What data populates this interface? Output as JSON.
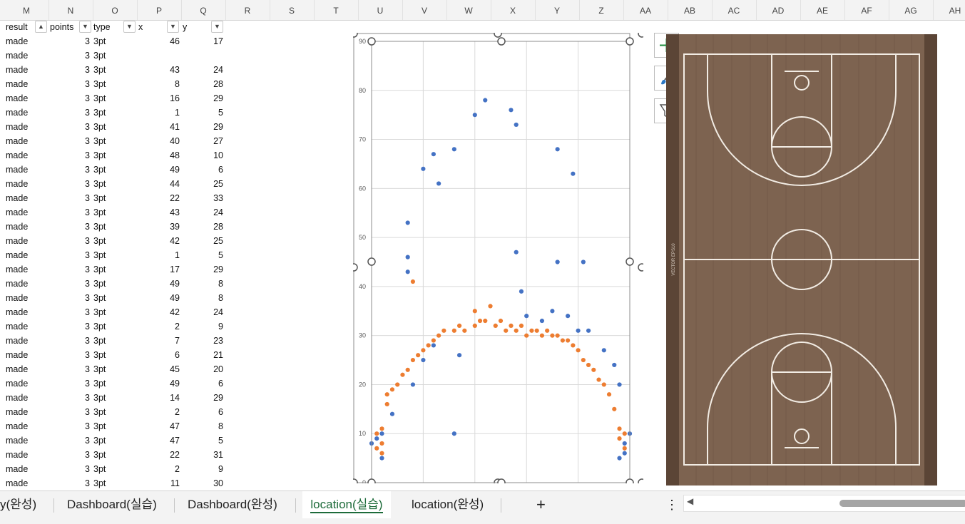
{
  "columns": [
    "M",
    "N",
    "O",
    "P",
    "Q",
    "R",
    "S",
    "T",
    "U",
    "V",
    "W",
    "X",
    "Y",
    "Z",
    "AA",
    "AB",
    "AC",
    "AD",
    "AE",
    "AF",
    "AG",
    "AH"
  ],
  "table": {
    "headers": [
      "result",
      "points",
      "type",
      "x",
      "y"
    ],
    "rows": [
      [
        "made",
        "3",
        "3pt",
        "46",
        "17"
      ],
      [
        "made",
        "3",
        "3pt",
        "",
        ""
      ],
      [
        "made",
        "3",
        "3pt",
        "43",
        "24"
      ],
      [
        "made",
        "3",
        "3pt",
        "8",
        "28"
      ],
      [
        "made",
        "3",
        "3pt",
        "16",
        "29"
      ],
      [
        "made",
        "3",
        "3pt",
        "1",
        "5"
      ],
      [
        "made",
        "3",
        "3pt",
        "41",
        "29"
      ],
      [
        "made",
        "3",
        "3pt",
        "40",
        "27"
      ],
      [
        "made",
        "3",
        "3pt",
        "48",
        "10"
      ],
      [
        "made",
        "3",
        "3pt",
        "49",
        "6"
      ],
      [
        "made",
        "3",
        "3pt",
        "44",
        "25"
      ],
      [
        "made",
        "3",
        "3pt",
        "22",
        "33"
      ],
      [
        "made",
        "3",
        "3pt",
        "43",
        "24"
      ],
      [
        "made",
        "3",
        "3pt",
        "39",
        "28"
      ],
      [
        "made",
        "3",
        "3pt",
        "42",
        "25"
      ],
      [
        "made",
        "3",
        "3pt",
        "1",
        "5"
      ],
      [
        "made",
        "3",
        "3pt",
        "17",
        "29"
      ],
      [
        "made",
        "3",
        "3pt",
        "49",
        "8"
      ],
      [
        "made",
        "3",
        "3pt",
        "49",
        "8"
      ],
      [
        "made",
        "3",
        "3pt",
        "42",
        "24"
      ],
      [
        "made",
        "3",
        "3pt",
        "2",
        "9"
      ],
      [
        "made",
        "3",
        "3pt",
        "7",
        "23"
      ],
      [
        "made",
        "3",
        "3pt",
        "6",
        "21"
      ],
      [
        "made",
        "3",
        "3pt",
        "45",
        "20"
      ],
      [
        "made",
        "3",
        "3pt",
        "49",
        "6"
      ],
      [
        "made",
        "3",
        "3pt",
        "14",
        "29"
      ],
      [
        "made",
        "3",
        "3pt",
        "2",
        "6"
      ],
      [
        "made",
        "3",
        "3pt",
        "47",
        "8"
      ],
      [
        "made",
        "3",
        "3pt",
        "47",
        "5"
      ],
      [
        "made",
        "3",
        "3pt",
        "22",
        "31"
      ],
      [
        "made",
        "3",
        "3pt",
        "2",
        "9"
      ],
      [
        "made",
        "3",
        "3pt",
        "11",
        "30"
      ]
    ]
  },
  "chart_data": {
    "type": "scatter",
    "xlim": [
      0,
      50
    ],
    "ylim": [
      0,
      90
    ],
    "yticks": [
      "0",
      "10",
      "20",
      "30",
      "40",
      "50",
      "60",
      "70",
      "80",
      "90"
    ],
    "grid": true,
    "colors": [
      "#4472c4",
      "#ed7d31"
    ],
    "series": [
      {
        "points": [
          [
            2,
            10
          ],
          [
            0,
            8
          ],
          [
            2,
            5
          ],
          [
            1,
            9
          ],
          [
            4,
            14
          ],
          [
            8,
            20
          ],
          [
            10,
            25
          ],
          [
            12,
            28
          ],
          [
            17,
            26
          ],
          [
            7,
            53
          ],
          [
            7,
            46
          ],
          [
            7,
            43
          ],
          [
            10,
            64
          ],
          [
            13,
            61
          ],
          [
            12,
            67
          ],
          [
            16,
            68
          ],
          [
            20,
            75
          ],
          [
            22,
            78
          ],
          [
            27,
            76
          ],
          [
            28,
            73
          ],
          [
            36,
            68
          ],
          [
            39,
            63
          ],
          [
            28,
            47
          ],
          [
            36,
            45
          ],
          [
            41,
            45
          ],
          [
            29,
            39
          ],
          [
            16,
            10
          ],
          [
            30,
            34
          ],
          [
            33,
            33
          ],
          [
            35,
            35
          ],
          [
            38,
            34
          ],
          [
            40,
            31
          ],
          [
            42,
            31
          ],
          [
            45,
            27
          ],
          [
            47,
            24
          ],
          [
            48,
            20
          ],
          [
            50,
            10
          ],
          [
            49,
            6
          ],
          [
            49,
            8
          ],
          [
            48,
            5
          ]
        ]
      },
      {
        "points": [
          [
            1,
            10
          ],
          [
            2,
            11
          ],
          [
            2,
            8
          ],
          [
            1,
            7
          ],
          [
            2,
            6
          ],
          [
            3,
            18
          ],
          [
            3,
            16
          ],
          [
            4,
            19
          ],
          [
            5,
            20
          ],
          [
            6,
            22
          ],
          [
            7,
            23
          ],
          [
            8,
            25
          ],
          [
            9,
            26
          ],
          [
            10,
            27
          ],
          [
            11,
            28
          ],
          [
            12,
            29
          ],
          [
            13,
            30
          ],
          [
            14,
            31
          ],
          [
            16,
            31
          ],
          [
            17,
            32
          ],
          [
            18,
            31
          ],
          [
            20,
            32
          ],
          [
            22,
            33
          ],
          [
            24,
            32
          ],
          [
            26,
            31
          ],
          [
            28,
            31
          ],
          [
            30,
            30
          ],
          [
            32,
            31
          ],
          [
            34,
            31
          ],
          [
            36,
            30
          ],
          [
            38,
            29
          ],
          [
            39,
            28
          ],
          [
            40,
            27
          ],
          [
            41,
            25
          ],
          [
            42,
            24
          ],
          [
            43,
            23
          ],
          [
            44,
            21
          ],
          [
            45,
            20
          ],
          [
            46,
            18
          ],
          [
            47,
            15
          ],
          [
            48,
            11
          ],
          [
            48,
            9
          ],
          [
            49,
            7
          ],
          [
            49,
            10
          ],
          [
            8,
            41
          ],
          [
            20,
            35
          ],
          [
            21,
            33
          ],
          [
            23,
            36
          ],
          [
            25,
            33
          ],
          [
            27,
            32
          ],
          [
            29,
            32
          ],
          [
            31,
            31
          ],
          [
            33,
            30
          ],
          [
            35,
            30
          ],
          [
            37,
            29
          ]
        ]
      }
    ]
  },
  "side_icons": [
    "plus-icon",
    "brush-icon",
    "funnel-icon"
  ],
  "court": {
    "watermark": "VECTOR EPS10",
    "wood": "#7a5f48",
    "line": "#f2ece4"
  },
  "tabs": [
    {
      "label": "y(완성)",
      "active": false
    },
    {
      "label": "Dashboard(실습)",
      "active": false
    },
    {
      "label": "Dashboard(완성)",
      "active": false
    },
    {
      "label": "location(실습)",
      "active": true
    },
    {
      "label": "location(완성)",
      "active": false
    }
  ],
  "tabbar": {
    "add": "+",
    "more": "⋮",
    "scroll_left": "◀"
  }
}
